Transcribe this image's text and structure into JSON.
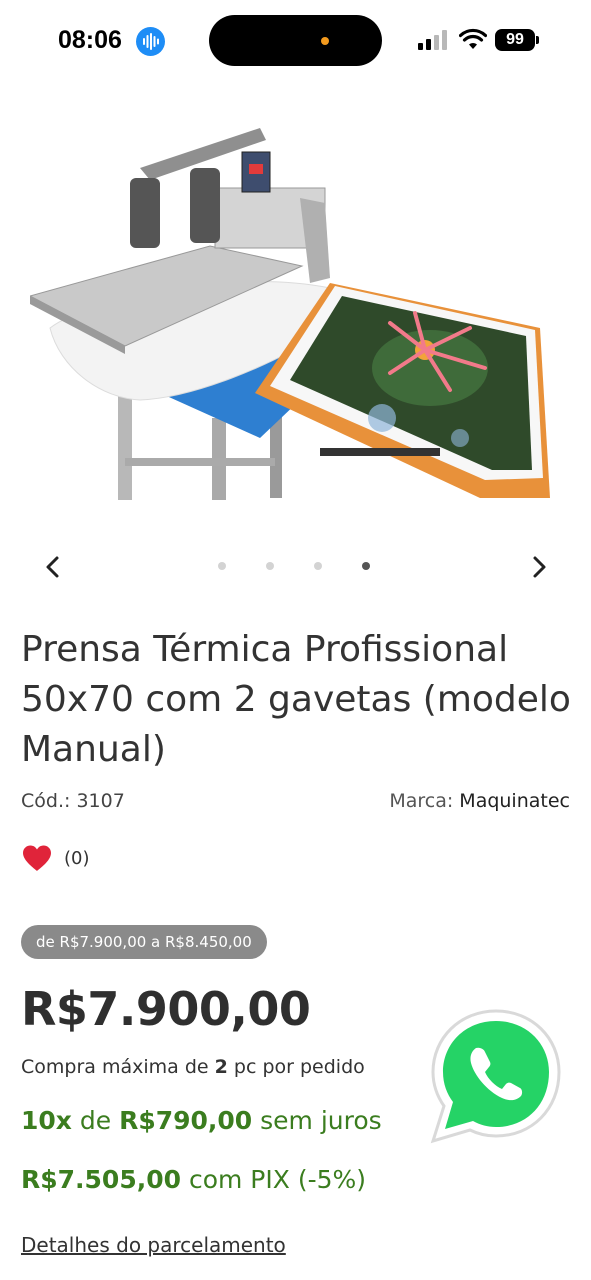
{
  "status_bar": {
    "time": "08:06",
    "battery": "99"
  },
  "carousel": {
    "dots": 4,
    "active_index": 3
  },
  "product": {
    "title": "Prensa Térmica Profissional 50x70 com 2 gavetas (modelo Manual)",
    "sku_label": "Cód.:",
    "sku": "3107",
    "brand_label": "Marca:",
    "brand": "Maquinatec",
    "favorites": "(0)",
    "price_range": "de R$7.900,00 a R$8.450,00",
    "price": "R$7.900,00",
    "max_buy_prefix": "Compra máxima de",
    "max_buy_qty": "2",
    "max_buy_suffix": "pc por pedido",
    "installments_count": "10x",
    "installments_de": "de",
    "installments_value": "R$790,00",
    "installments_suffix": "sem juros",
    "pix_price": "R$7.505,00",
    "pix_suffix": "com PIX (-5%)",
    "details_link": "Detalhes do parcelamento"
  },
  "colors": {
    "accent_green": "#3b7d1f",
    "favorite_red": "#e0243a",
    "whatsapp_green": "#25d366",
    "badge_gray": "#8a8a8a"
  }
}
